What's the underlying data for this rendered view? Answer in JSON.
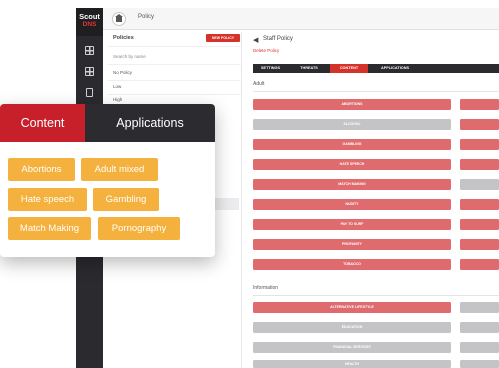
{
  "app": {
    "logo_line1": "Scout",
    "logo_line2": "DNS"
  },
  "topbar": {
    "crumb": "Policy"
  },
  "policies": {
    "header": "Policies",
    "new_button": "NEW POLICY",
    "search_placeholder": "Search by name",
    "items": [
      "No Policy",
      "Low",
      "High"
    ]
  },
  "staff": {
    "title": "Staff Policy",
    "link": "Delete Policy",
    "tabs": [
      "SETTINGS",
      "THREATS",
      "CONTENT",
      "APPLICATIONS"
    ],
    "active_tab": "CONTENT",
    "sections": {
      "adult": "Adult",
      "information": "Information"
    },
    "adult_categories": [
      "ABORTIONS",
      "ALCOHOL",
      "GAMBLING",
      "HATE SPEECH",
      "MATCH MAKING",
      "NUDITY",
      "PAY TO SURF",
      "PROFANITY",
      "TOBACCO"
    ],
    "info_categories": [
      "ALTERNATIVE LIFESTYLE",
      "EDUCATION",
      "FINANCIAL SERVICES",
      "HEALTH"
    ]
  },
  "card": {
    "tabs": {
      "content": "Content",
      "applications": "Applications"
    },
    "pills": [
      "Abortions",
      "Adult mixed",
      "Hate speech",
      "Gambling",
      "Match Making",
      "Pornography"
    ]
  },
  "colors": {
    "accent": "#c8202a",
    "dark": "#2c2c30",
    "pill": "#f5b13d",
    "blocked": "#df6b6e",
    "allowed": "#c4c4c6"
  },
  "icons": {
    "home": "home-icon",
    "back": "back-arrow-icon",
    "rail": [
      "dashboard-icon",
      "reports-icon",
      "document-icon"
    ]
  }
}
